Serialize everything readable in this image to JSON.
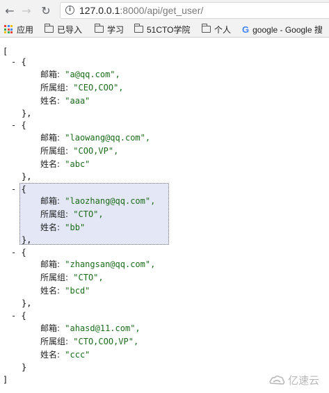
{
  "browser": {
    "url_host": "127.0.0.1",
    "url_rest": ":8000/api/get_user/",
    "back_glyph": "←",
    "forward_glyph": "→",
    "reload_glyph": "↻",
    "info_glyph": "i"
  },
  "bookmarks": {
    "apps_label": "应用",
    "apps_colors": [
      "#ea4335",
      "#4285f4",
      "#fbbc05",
      "#34a853",
      "#ea4335",
      "#4285f4",
      "#fbbc05",
      "#34a853",
      "#ea4335"
    ],
    "items": [
      {
        "label": "已导入",
        "icon": "folder-icon"
      },
      {
        "label": "学习",
        "icon": "folder-icon"
      },
      {
        "label": "51CTO学院",
        "icon": "folder-icon"
      },
      {
        "label": "个人",
        "icon": "folder-icon"
      },
      {
        "label": "google - Google 搜",
        "icon": "google-icon"
      }
    ]
  },
  "json_view": {
    "open_bracket": "[",
    "close_bracket": "]",
    "toggle_glyph": "-",
    "open_brace": "{",
    "close_brace_comma": "},",
    "close_brace": "}",
    "key_email": "邮箱:",
    "key_group": "所属组:",
    "key_name": "姓名:",
    "users": [
      {
        "email": "\"a@qq.com\",",
        "group": "\"CEO,COO\",",
        "name": "\"aaa\""
      },
      {
        "email": "\"laowang@qq.com\",",
        "group": "\"COO,VP\",",
        "name": "\"abc\""
      },
      {
        "email": "\"laozhang@qq.com\",",
        "group": "\"CTO\",",
        "name": "\"bb\""
      },
      {
        "email": "\"zhangsan@qq.com\",",
        "group": "\"CTO\",",
        "name": "\"bcd\""
      },
      {
        "email": "\"ahasd@11.com\",",
        "group": "\"CTO,COO,VP\",",
        "name": "\"ccc\""
      }
    ],
    "string_color": "#1a6b1a",
    "highlight_color": "#e4e8f6"
  },
  "watermark": {
    "label": "亿速云"
  }
}
